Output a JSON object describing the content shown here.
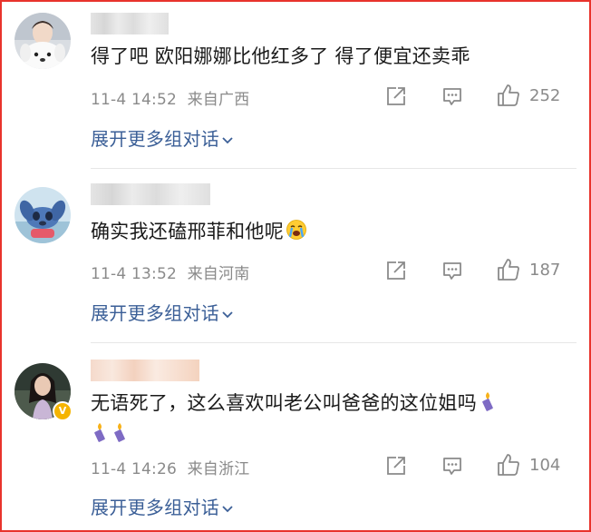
{
  "comments": [
    {
      "text": "得了吧 欧阳娜娜比他红多了  得了便宜还卖乖",
      "time": "11-4 14:52",
      "location": "来自广西",
      "likes": "252",
      "expand_label": "展开更多组对话",
      "avatar_icon": "dog-avatar-icon"
    },
    {
      "text": "确实我还磕邢菲和他呢",
      "time": "11-4 13:52",
      "location": "来自河南",
      "likes": "187",
      "expand_label": "展开更多组对话",
      "avatar_icon": "stitch-avatar-icon",
      "emoji": "crying-face-icon"
    },
    {
      "text_line1": "无语死了，这么喜欢叫老公叫爸爸的这位姐吗",
      "time": "11-4 14:26",
      "location": "来自浙江",
      "likes": "104",
      "expand_label": "展开更多组对话",
      "avatar_icon": "woman-avatar-icon",
      "verified_badge": "V",
      "emoji": "candle-icon"
    }
  ],
  "colors": {
    "frame_border": "#e8332c",
    "link": "#3b5f97",
    "meta": "#8a8a8a",
    "text": "#1a1a1a"
  }
}
